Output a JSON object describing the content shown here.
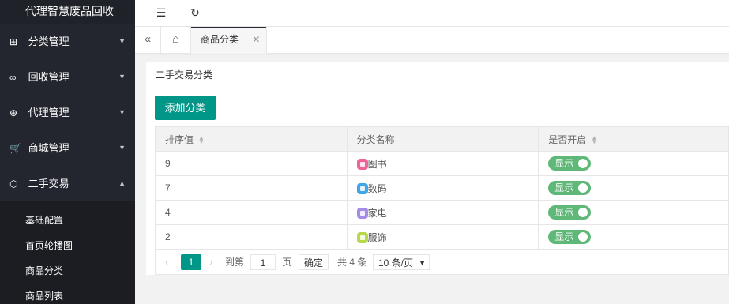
{
  "sidebar": {
    "title": "代理智慧废品回收",
    "items": [
      {
        "label": "分类管理",
        "icon": "grid-icon",
        "glyph": "⊞",
        "arrow": "▼"
      },
      {
        "label": "回收管理",
        "icon": "link-icon",
        "glyph": "∞",
        "arrow": "▼"
      },
      {
        "label": "代理管理",
        "icon": "plus-circle-icon",
        "glyph": "⊕",
        "arrow": "▼"
      },
      {
        "label": "商城管理",
        "icon": "cart-icon",
        "glyph": "🛒",
        "arrow": "▼"
      },
      {
        "label": "二手交易",
        "icon": "box-icon",
        "glyph": "⬡",
        "arrow": "▲"
      }
    ],
    "subitems": [
      "基础配置",
      "首页轮播图",
      "商品分类",
      "商品列表"
    ]
  },
  "header": {
    "menu_glyph": "☰",
    "refresh_glyph": "↻"
  },
  "tabs": {
    "back_glyph": "«",
    "home_glyph": "⌂",
    "active_label": "商品分类",
    "close_glyph": "✕"
  },
  "card": {
    "title": "二手交易分类",
    "add_button": "添加分类"
  },
  "table": {
    "headers": [
      "排序值",
      "分类名称",
      "是否开启"
    ],
    "rows": [
      {
        "sort": "9",
        "name": "图书",
        "icon_color": "#f0649a",
        "status": "显示"
      },
      {
        "sort": "7",
        "name": "数码",
        "icon_color": "#3fa7e8",
        "status": "显示"
      },
      {
        "sort": "4",
        "name": "家电",
        "icon_color": "#a78be8",
        "status": "显示"
      },
      {
        "sort": "2",
        "name": "服饰",
        "icon_color": "#b6d94c",
        "status": "显示"
      }
    ]
  },
  "pagination": {
    "prev": "‹",
    "current": "1",
    "next": "›",
    "goto_label": "到第",
    "page_input": "1",
    "page_unit": "页",
    "confirm": "确定",
    "total": "共 4 条",
    "page_size": "10 条/页",
    "caret": "▼"
  },
  "colors": {
    "accent": "#009688",
    "switch_on": "#5fb878",
    "sidebar_bg": "#23262e"
  }
}
